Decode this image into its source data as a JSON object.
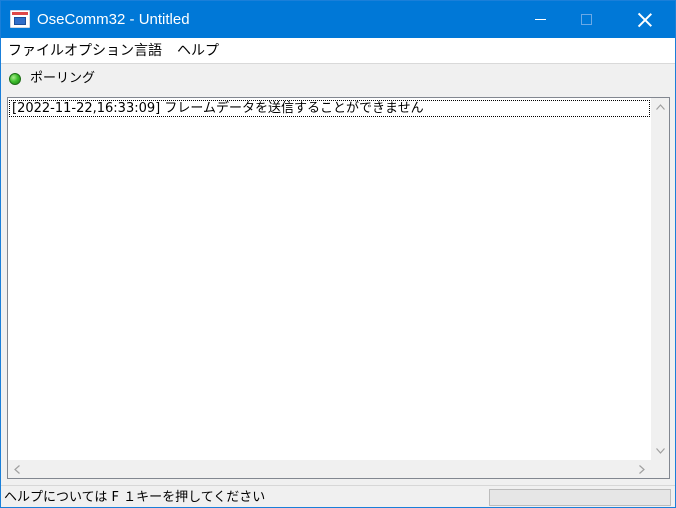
{
  "window": {
    "title": "OseComm32 - Untitled",
    "accent_color": "#0078d7",
    "icons": {
      "app": "app-window-icon",
      "minimize": "minimize-icon",
      "maximize": "maximize-icon",
      "close": "close-icon"
    }
  },
  "menu": {
    "items": [
      {
        "label": "ファイル"
      },
      {
        "label": "オプション"
      },
      {
        "label": "言語"
      },
      {
        "label": "ヘルプ"
      }
    ]
  },
  "status": {
    "indicator_color": "#3fbf2e",
    "indicator_icon": "status-led-icon",
    "label": "ポーリング"
  },
  "log": {
    "entries": [
      {
        "text": "[2022-11-22,16:33:09]  フレームデータを送信することができません"
      }
    ]
  },
  "statusbar": {
    "help_text": "ヘルプについては F １キーを押してください"
  }
}
